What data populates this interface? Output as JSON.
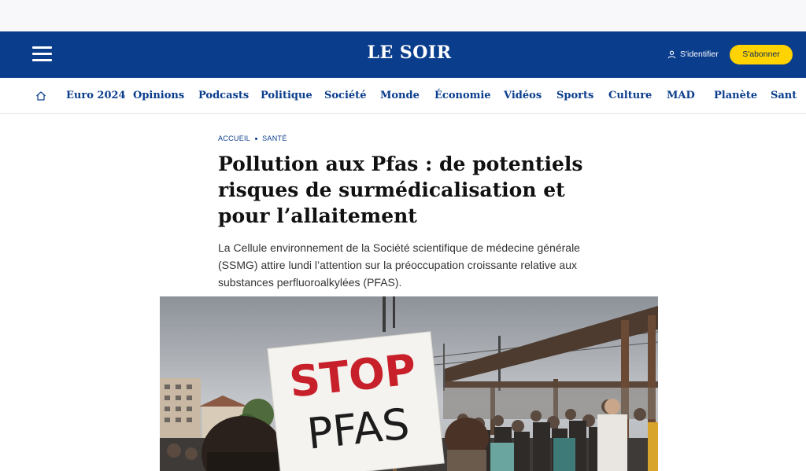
{
  "header": {
    "logo": "LE SOIR",
    "signin_label": "S'identifier",
    "subscribe_label": "S'abonner"
  },
  "nav": {
    "items": [
      "Euro 2024",
      "Opinions",
      "Podcasts",
      "Politique",
      "Société",
      "Monde",
      "Économie",
      "Vidéos",
      "Sports",
      "Culture",
      "MAD",
      "Planète",
      "Sant"
    ]
  },
  "breadcrumb": {
    "home": "ACCUEIL",
    "section": "SANTÉ"
  },
  "article": {
    "headline": "Pollution aux Pfas : de potentiels risques de surmédicalisation et pour l’allaitement",
    "lead": "La Cellule environnement de la Société scientifique de médecine générale (SSMG) attire lundi l’attention sur la préoccupation croissante relative aux substances perfluoroalkylées (PFAS).",
    "photo": {
      "sign_line1": "STOP",
      "sign_line2": "PFAS"
    }
  },
  "colors": {
    "brand_blue": "#0a3d8c",
    "subscribe_yellow": "#ffd300",
    "sign_red": "#c8202a"
  }
}
